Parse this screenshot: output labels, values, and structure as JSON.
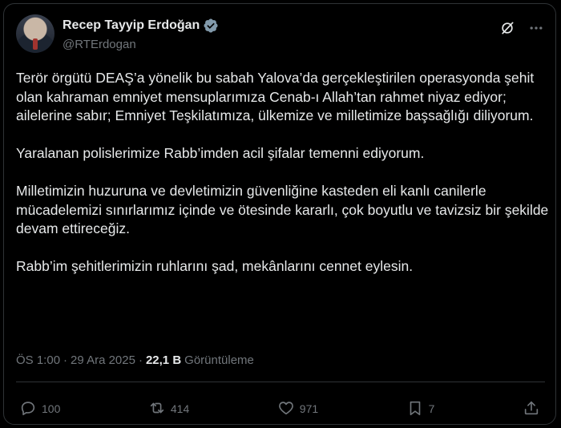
{
  "author": {
    "name": "Recep Tayyip Erdoğan",
    "handle": "@RTErdogan",
    "verified_icon": "verified-badge-icon"
  },
  "top_icons": [
    "grok-icon",
    "more-options-icon"
  ],
  "tweet": {
    "paragraphs": [
      "Terör örgütü DEAŞ’a yönelik bu sabah Yalova’da gerçekleştirilen operasyonda şehit olan kahraman emniyet mensuplarımıza Cenab-ı Allah’tan rahmet niyaz ediyor; ailelerine sabır; Emniyet Teşkilatımıza, ülkemize ve milletimize başsağlığı diliyorum.",
      "Yaralanan polislerimize Rabb’imden acil şifalar temenni ediyorum.",
      "Milletimizin huzuruna ve devletimizin güvenliğine kasteden eli kanlı canilerle mücadelemizi sınırlarımız içinde ve ötesinde kararlı, çok boyutlu ve tavizsiz bir şekilde devam ettireceğiz.",
      "Rabb’im şehitlerimizin ruhlarını şad, mekânlarını cennet eylesin."
    ]
  },
  "meta": {
    "time": "ÖS 1:00",
    "separator": "·",
    "date": "29 Ara 2025",
    "views_count": "22,1 B",
    "views_label": "Görüntüleme"
  },
  "actions": {
    "replies": "100",
    "reposts": "414",
    "likes": "971",
    "bookmarks": "7"
  },
  "colors": {
    "background": "#000000",
    "text": "#e7e9ea",
    "muted": "#71767b",
    "border": "#2f3336",
    "verified": "#829aab"
  }
}
